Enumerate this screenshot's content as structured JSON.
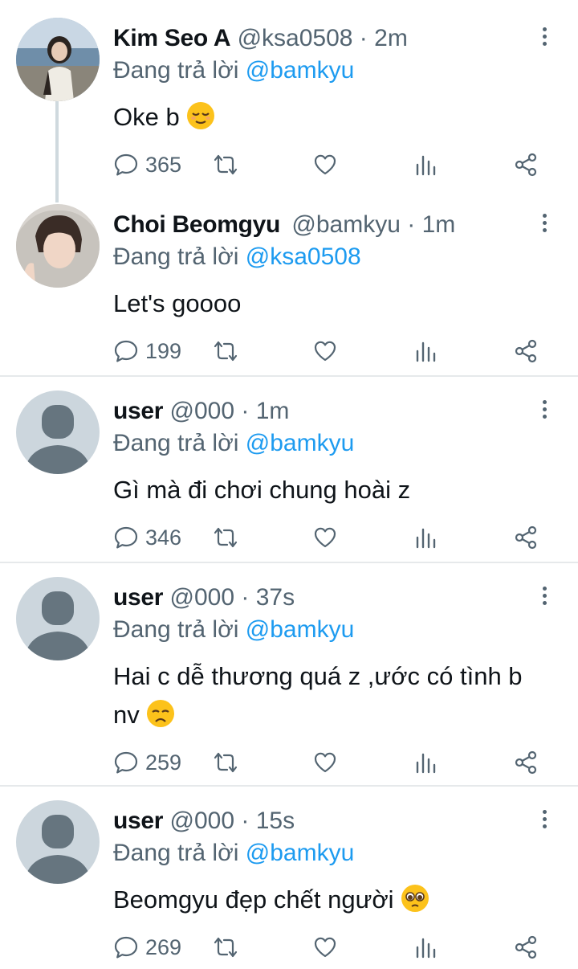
{
  "tweets": [
    {
      "name": "Kim Seo A",
      "handle": "@ksa0508",
      "dot": "·",
      "time": "2m",
      "replying_prefix": "Đang trả lời ",
      "replying_to": "@bamkyu",
      "text": "Oke b",
      "emoji": "relieved-face",
      "replies": "365",
      "avatar": "photo-woman-beach"
    },
    {
      "name": "Choi Beomgyu",
      "handle": "@bamkyu",
      "dot": "·",
      "time": "1m",
      "replying_prefix": "Đang trả lời ",
      "replying_to": "@ksa0508",
      "text": "Let's goooo",
      "emoji": "",
      "replies": "199",
      "avatar": "photo-man-hoodie"
    },
    {
      "name": "user",
      "handle": "@000",
      "dot": "·",
      "time": "1m",
      "replying_prefix": "Đang trả lời ",
      "replying_to": "@bamkyu",
      "text": "Gì mà đi chơi chung hoài z",
      "emoji": "",
      "replies": "346",
      "avatar": "default-avatar"
    },
    {
      "name": "user",
      "handle": "@000",
      "dot": "·",
      "time": "37s",
      "replying_prefix": "Đang trả lời ",
      "replying_to": "@bamkyu",
      "text": "Hai c dễ thương quá z ,ước có tình b nv",
      "emoji": "disappointed-face",
      "replies": "259",
      "avatar": "default-avatar"
    },
    {
      "name": "user",
      "handle": "@000",
      "dot": "·",
      "time": "15s",
      "replying_prefix": "Đang trả lời ",
      "replying_to": "@bamkyu",
      "text": "Beomgyu đẹp chết người",
      "emoji": "pleading-face",
      "replies": "269",
      "avatar": "default-avatar"
    }
  ],
  "icons": {
    "reply": "comment-icon",
    "retweet": "retweet-icon",
    "like": "heart-icon",
    "views": "bar-chart-icon",
    "share": "share-icon",
    "more": "more-vertical-icon"
  },
  "colors": {
    "mention": "#1d9bf0",
    "secondary": "#536471",
    "divider": "#e6e9eb",
    "default_avatar_bg": "#ccd6dd",
    "default_avatar_fg": "#66757f"
  }
}
